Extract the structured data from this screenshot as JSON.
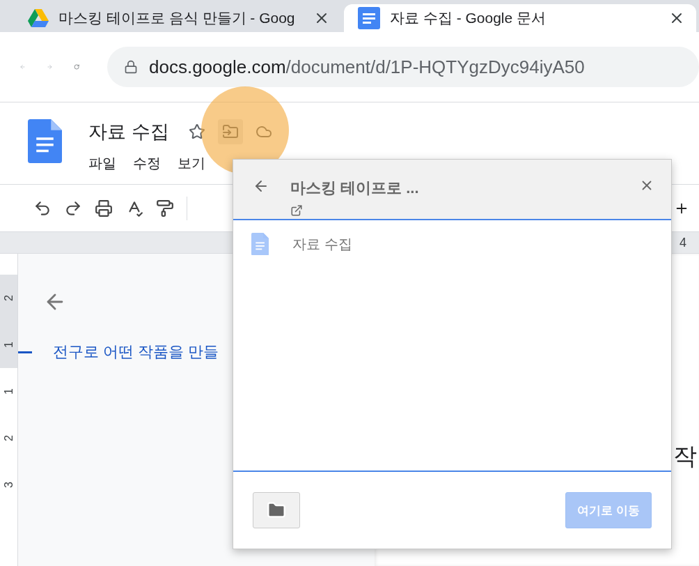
{
  "browser": {
    "tabs": [
      {
        "title": "마스킹 테이프로 음식 만들기 - Goog",
        "kind": "drive",
        "selected": false
      },
      {
        "title": "자료 수집 - Google 문서",
        "kind": "docs",
        "selected": true
      }
    ],
    "url": {
      "host": "docs.google.com",
      "path": "/document/d/1P-HQTYgzDyc94iyA50"
    }
  },
  "document": {
    "title": "자료 수집",
    "menu": [
      "파일",
      "수정",
      "보기"
    ],
    "horizontal_ruler": "4",
    "vertical_ruler": [
      {
        "label": "2",
        "shaded": true
      },
      {
        "label": "1",
        "shaded": true
      },
      {
        "label": "1",
        "shaded": false
      },
      {
        "label": "2",
        "shaded": false
      },
      {
        "label": "3",
        "shaded": false
      }
    ],
    "outline_heading": "전구로 어떤 작품을 만들",
    "page_fragment": "작"
  },
  "move_dialog": {
    "folder": "마스킹 테이프로 ...",
    "items": [
      {
        "name": "자료 수집"
      }
    ],
    "move_button": {
      "label": "여기로 이동",
      "disabled": true
    }
  }
}
